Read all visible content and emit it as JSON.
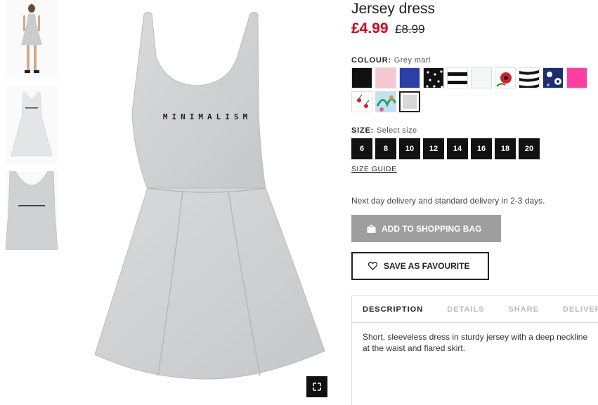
{
  "product": {
    "title": "Jersey dress",
    "price_sale": "£4.99",
    "price_original": "£8.99",
    "print_text": "MINIMALISM"
  },
  "colour": {
    "label": "COLOUR:",
    "selected": "Grey marl",
    "swatches": [
      {
        "name": "black",
        "color": "#111111"
      },
      {
        "name": "light-pink",
        "color": "#f7c6d3"
      },
      {
        "name": "blue",
        "color": "#2a3fa8"
      },
      {
        "name": "black-dot",
        "color": "#111111"
      },
      {
        "name": "black-white-stripe",
        "color": "#111111"
      },
      {
        "name": "white",
        "color": "#f4f6f8"
      },
      {
        "name": "red-floral",
        "color": "#d4202a"
      },
      {
        "name": "zebra",
        "color": "#222222"
      },
      {
        "name": "blue-floral",
        "color": "#1c2e6e"
      },
      {
        "name": "hot-pink",
        "color": "#ff3fa0"
      },
      {
        "name": "white-cherry",
        "color": "#ffffff"
      },
      {
        "name": "tropical-print",
        "color": "#5aa9d6"
      },
      {
        "name": "grey-marl",
        "color": "#d6d8da"
      }
    ]
  },
  "size": {
    "label": "SIZE:",
    "placeholder": "Select size",
    "options": [
      "6",
      "8",
      "10",
      "12",
      "14",
      "16",
      "18",
      "20"
    ],
    "guide_label": "SIZE GUIDE"
  },
  "delivery_text": "Next day delivery and standard delivery in 2-3 days.",
  "actions": {
    "add_to_bag": "ADD TO SHOPPING BAG",
    "save_favourite": "SAVE AS FAVOURITE"
  },
  "tabs": [
    "DESCRIPTION",
    "DETAILS",
    "SHARE",
    "DELIVERY"
  ],
  "description": "Short, sleeveless dress in sturdy jersey with a deep neckline at the waist and flared skirt."
}
